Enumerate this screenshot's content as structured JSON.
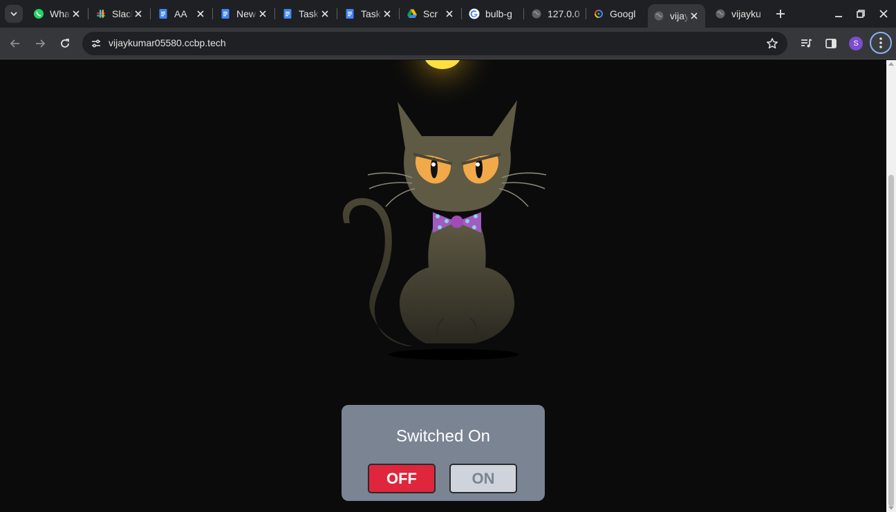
{
  "browser": {
    "tabs": [
      {
        "title": "WhatsApp",
        "icon": "whatsapp-icon"
      },
      {
        "title": "Slack",
        "icon": "slack-icon"
      },
      {
        "title": "AA",
        "icon": "docs-icon"
      },
      {
        "title": "New",
        "icon": "docs-icon"
      },
      {
        "title": "Task",
        "icon": "docs-icon"
      },
      {
        "title": "Task",
        "icon": "docs-icon"
      },
      {
        "title": "Scr",
        "icon": "drive-icon"
      },
      {
        "title": "bulb-g",
        "icon": "google-icon"
      },
      {
        "title": "127.0.0",
        "icon": "globe-icon"
      },
      {
        "title": "Googl",
        "icon": "lens-icon"
      },
      {
        "title": "vijaykumar",
        "icon": "globe-icon",
        "active": true
      },
      {
        "title": "vijayku",
        "icon": "globe-icon"
      }
    ],
    "url": "vijaykumar05580.ccbp.tech",
    "profile_initial": "S",
    "accent": "#8ab4f8"
  },
  "page": {
    "status_text": "Switched On",
    "off_label": "OFF",
    "on_label": "ON",
    "off_color": "#e0263c",
    "panel_color": "#7a8493",
    "background": "#0b0b0b"
  }
}
